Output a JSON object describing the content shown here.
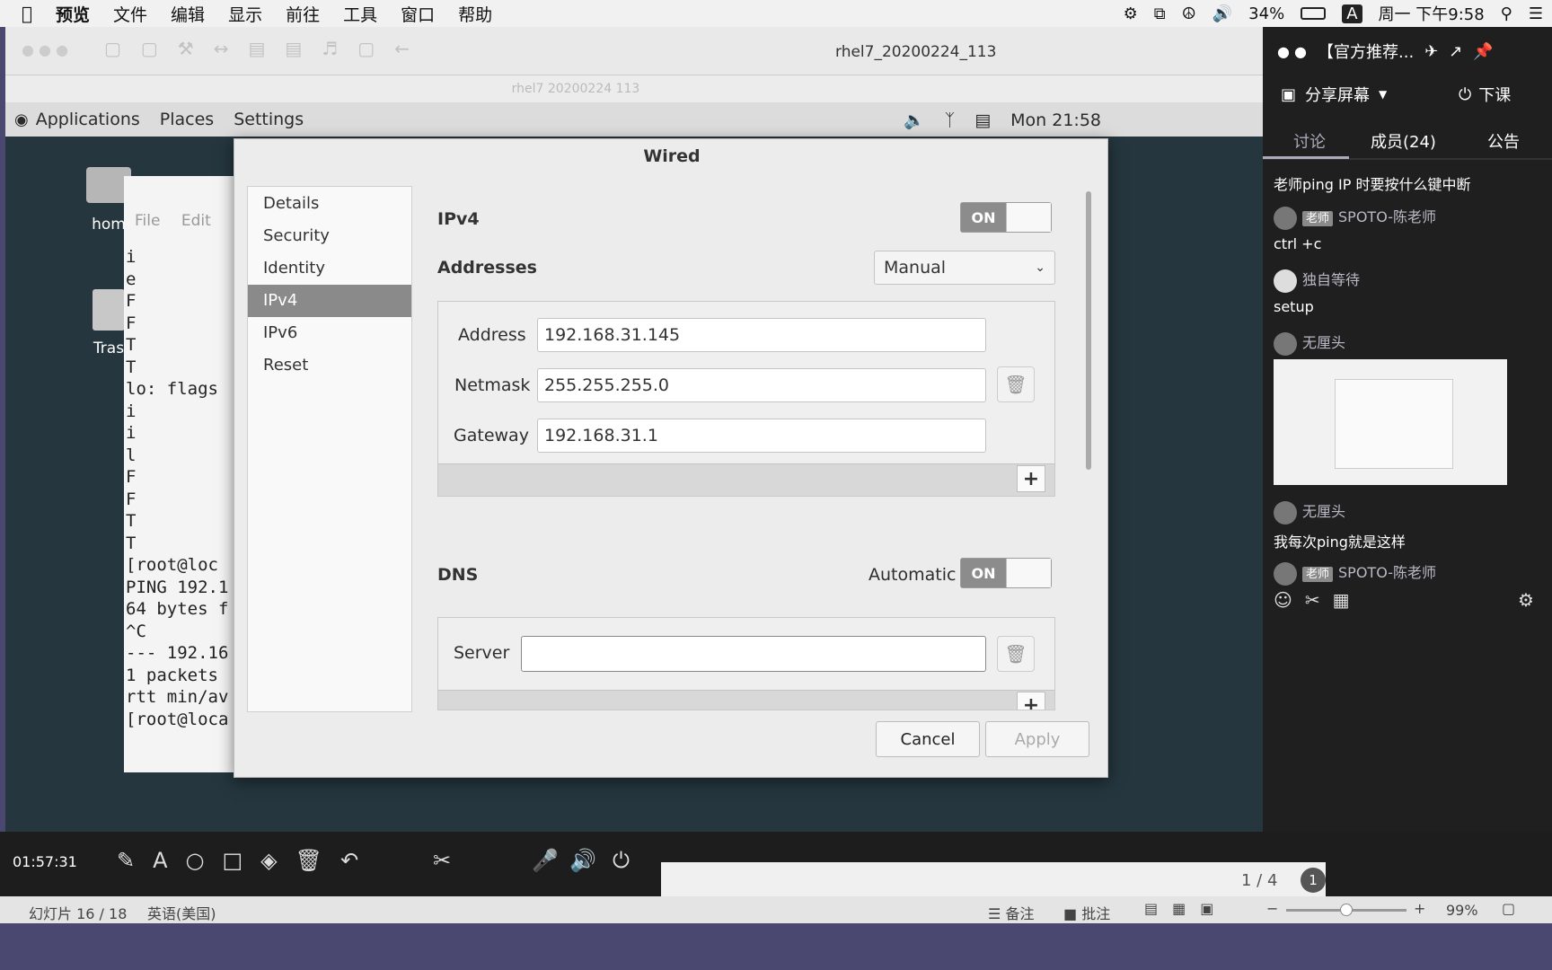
{
  "mac_menubar": {
    "apple_icon": "apple-icon",
    "items": [
      "预览",
      "文件",
      "编辑",
      "显示",
      "前往",
      "工具",
      "窗口",
      "帮助"
    ],
    "battery": "34%",
    "input_method": "A",
    "clock": "周一 下午9:58"
  },
  "vm": {
    "title": "rhel7_20200224_113",
    "subtitle": "rhel7 20200224 113"
  },
  "gnome": {
    "applications": "Applications",
    "places": "Places",
    "settings": "Settings",
    "clock": "Mon 21:58"
  },
  "desktop": {
    "home_label": "hom",
    "trash_label": "Tras",
    "term_menu_file": "File",
    "term_menu_edit": "Edit",
    "terminal_lines": [
      "i",
      "e",
      "F",
      "F",
      "T",
      "T",
      "",
      "lo: flags",
      "i",
      "i",
      "l",
      "F",
      "F",
      "T",
      "T",
      "",
      "[root@loc",
      "PING 192.1",
      "64 bytes f",
      "^C",
      "--- 192.16",
      "1 packets",
      "rtt min/av",
      "[root@loca"
    ]
  },
  "dialog": {
    "title": "Wired",
    "sidebar": [
      "Details",
      "Security",
      "Identity",
      "IPv4",
      "IPv6",
      "Reset"
    ],
    "selected": "IPv4",
    "ipv4_header": "IPv4",
    "ipv4_toggle": "ON",
    "addresses_label": "Addresses",
    "method": "Manual",
    "address_label": "Address",
    "address_value": "192.168.31.145",
    "netmask_label": "Netmask",
    "netmask_value": "255.255.255.0",
    "gateway_label": "Gateway",
    "gateway_value": "192.168.31.1",
    "dns_header": "DNS",
    "dns_auto_label": "Automatic",
    "dns_toggle": "ON",
    "server_label": "Server",
    "server_value": "",
    "cancel": "Cancel",
    "apply": "Apply"
  },
  "chat": {
    "title": "【官方推荐...",
    "share_screen": "分享屏幕",
    "end_class": "下课",
    "tabs": [
      "讨论",
      "成员(24)",
      "公告"
    ],
    "messages": [
      {
        "text": "老师ping IP 时要按什么键中断"
      },
      {
        "badge": "老师",
        "name": "SPOTO-陈老师",
        "text": "ctrl +c"
      },
      {
        "name": "独自等待",
        "text": "setup"
      },
      {
        "name": "无厘头",
        "text": ""
      },
      {
        "name": "无厘头",
        "text": "我每次ping就是这样"
      },
      {
        "badge": "老师",
        "name": "SPOTO-陈老师",
        "text": ""
      }
    ]
  },
  "control_bar": {
    "timer": "01:57:31",
    "page": "1 / 4",
    "page_badge": "1"
  },
  "statusbar": {
    "slide": "幻灯片 16 / 18",
    "language": "英语(美国)",
    "notes": "备注",
    "comments": "批注",
    "zoom": "99%"
  }
}
